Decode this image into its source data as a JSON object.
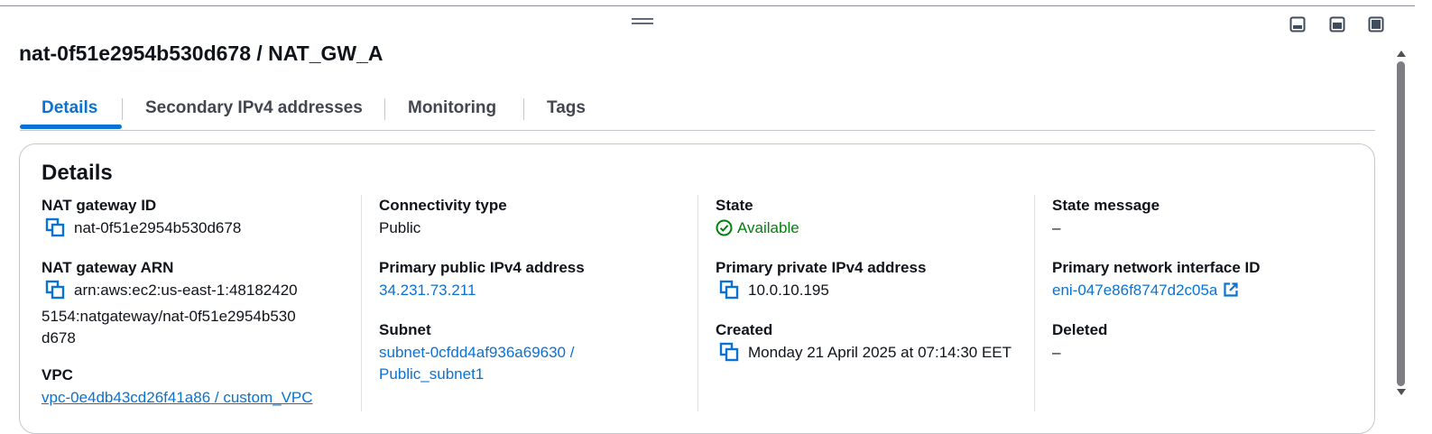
{
  "panel": {
    "title": "nat-0f51e2954b530d678 / NAT_GW_A"
  },
  "tabs": [
    {
      "label": "Details",
      "active": true
    },
    {
      "label": "Secondary IPv4 addresses",
      "active": false
    },
    {
      "label": "Monitoring",
      "active": false
    },
    {
      "label": "Tags",
      "active": false
    }
  ],
  "details": {
    "heading": "Details",
    "nat_gateway_id": {
      "label": "NAT gateway ID",
      "value": "nat-0f51e2954b530d678"
    },
    "nat_gateway_arn": {
      "label": "NAT gateway ARN",
      "value": "arn:aws:ec2:us-east-1:481824205154:natgateway/nat-0f51e2954b530d678"
    },
    "vpc": {
      "label": "VPC",
      "value": "vpc-0e4db43cd26f41a86 / custom_VPC"
    },
    "connectivity_type": {
      "label": "Connectivity type",
      "value": "Public"
    },
    "primary_public_ipv4": {
      "label": "Primary public IPv4 address",
      "value": "34.231.73.211"
    },
    "subnet": {
      "label": "Subnet",
      "value": "subnet-0cfdd4af936a69630 / Public_subnet1"
    },
    "state": {
      "label": "State",
      "value": "Available"
    },
    "primary_private_ipv4": {
      "label": "Primary private IPv4 address",
      "value": "10.0.10.195"
    },
    "created": {
      "label": "Created",
      "value": "Monday 21 April 2025 at 07:14:30 EET"
    },
    "state_message": {
      "label": "State message",
      "value": "–"
    },
    "primary_eni": {
      "label": "Primary network interface ID",
      "value": "eni-047e86f8747d2c05a"
    },
    "deleted": {
      "label": "Deleted",
      "value": "–"
    }
  },
  "colors": {
    "link": "#0972d3",
    "success": "#037f0c",
    "text": "#0f141a",
    "border": "#c6c6cd"
  },
  "icons": [
    "drag-handle-icon",
    "split-bottom-icon",
    "split-side-icon",
    "maximize-icon",
    "copy-icon",
    "status-positive-icon",
    "external-link-icon",
    "scroll-up-icon",
    "scroll-down-icon"
  ]
}
